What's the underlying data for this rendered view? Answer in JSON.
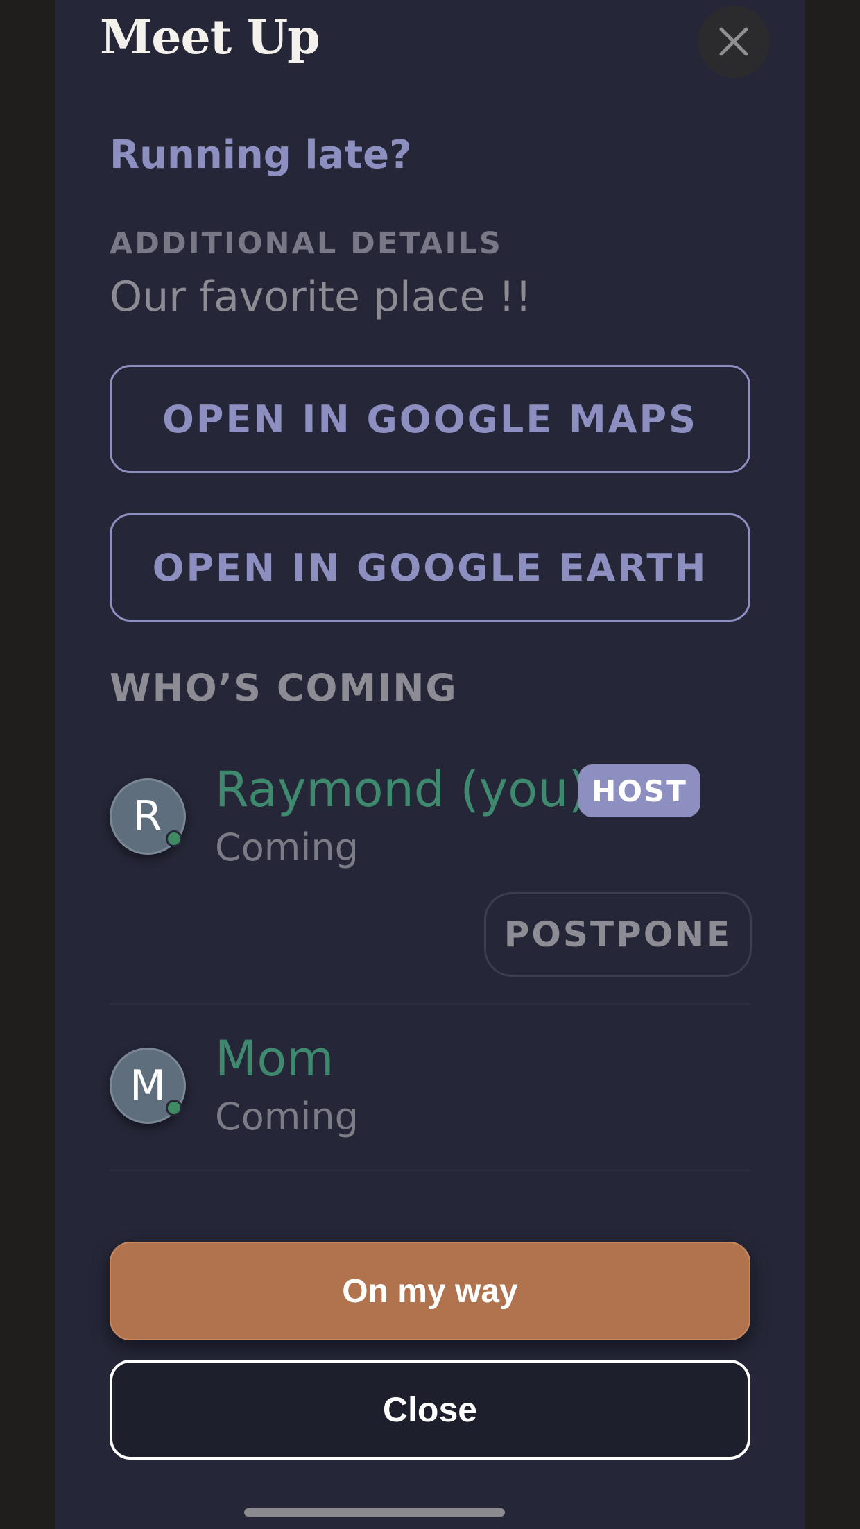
{
  "header": {
    "title": "Meet Up"
  },
  "meetup": {
    "heading": "Running late?",
    "details_label": "ADDITIONAL DETAILS",
    "details_value": "Our favorite place !!",
    "maps_button": "OPEN IN GOOGLE MAPS",
    "earth_button": "OPEN IN GOOGLE EARTH"
  },
  "attendees": {
    "section_title": "WHO’S COMING",
    "people": [
      {
        "initial": "R",
        "name": "Raymond (you)",
        "status": "Coming",
        "badge": "HOST",
        "online": true
      },
      {
        "initial": "M",
        "name": "Mom",
        "status": "Coming",
        "online": true
      }
    ],
    "postpone_label": "POSTPONE"
  },
  "actions": {
    "primary_label": "On my way",
    "secondary_label": "Close"
  },
  "icons": {
    "close": "close-icon"
  },
  "colors": {
    "background": "#252637",
    "accent": "#8d8fc0",
    "name_green": "#3f8a6f",
    "primary_button": "#b0734d"
  }
}
